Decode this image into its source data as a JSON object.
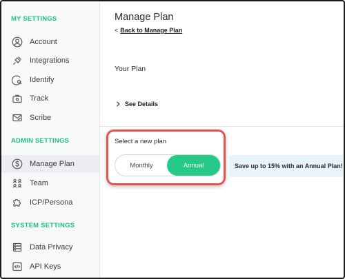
{
  "sidebar": {
    "my_settings_title": "MY SETTINGS",
    "my_settings": [
      {
        "label": "Account",
        "icon": "user-circle-icon"
      },
      {
        "label": "Integrations",
        "icon": "plug-icon"
      },
      {
        "label": "Identify",
        "icon": "search-person-icon"
      },
      {
        "label": "Track",
        "icon": "briefcase-icon"
      },
      {
        "label": "Scribe",
        "icon": "email-icon"
      }
    ],
    "admin_settings_title": "ADMIN SETTINGS",
    "admin_settings": [
      {
        "label": "Manage Plan",
        "icon": "dollar-circle-icon",
        "active": true
      },
      {
        "label": "Team",
        "icon": "team-icon"
      },
      {
        "label": "ICP/Persona",
        "icon": "puzzle-icon"
      }
    ],
    "system_settings_title": "SYSTEM SETTINGS",
    "system_settings": [
      {
        "label": "Data Privacy",
        "icon": "database-icon"
      },
      {
        "label": "API Keys",
        "icon": "code-icon"
      }
    ]
  },
  "main": {
    "title": "Manage Plan",
    "back_caret": "<",
    "back_link": "Back to Manage Plan",
    "your_plan": "Your Plan",
    "see_details": "See Details",
    "select_label": "Select a new plan",
    "plan_options": {
      "monthly": "Monthly",
      "annual": "Annual"
    },
    "selected_plan": "Annual",
    "promo": "Save up to 15% with an Annual Plan!"
  },
  "colors": {
    "accent_green": "#26c988",
    "section_green": "#1fc07f",
    "highlight_red": "#e0534e",
    "promo_bg": "#e8f4fb"
  }
}
